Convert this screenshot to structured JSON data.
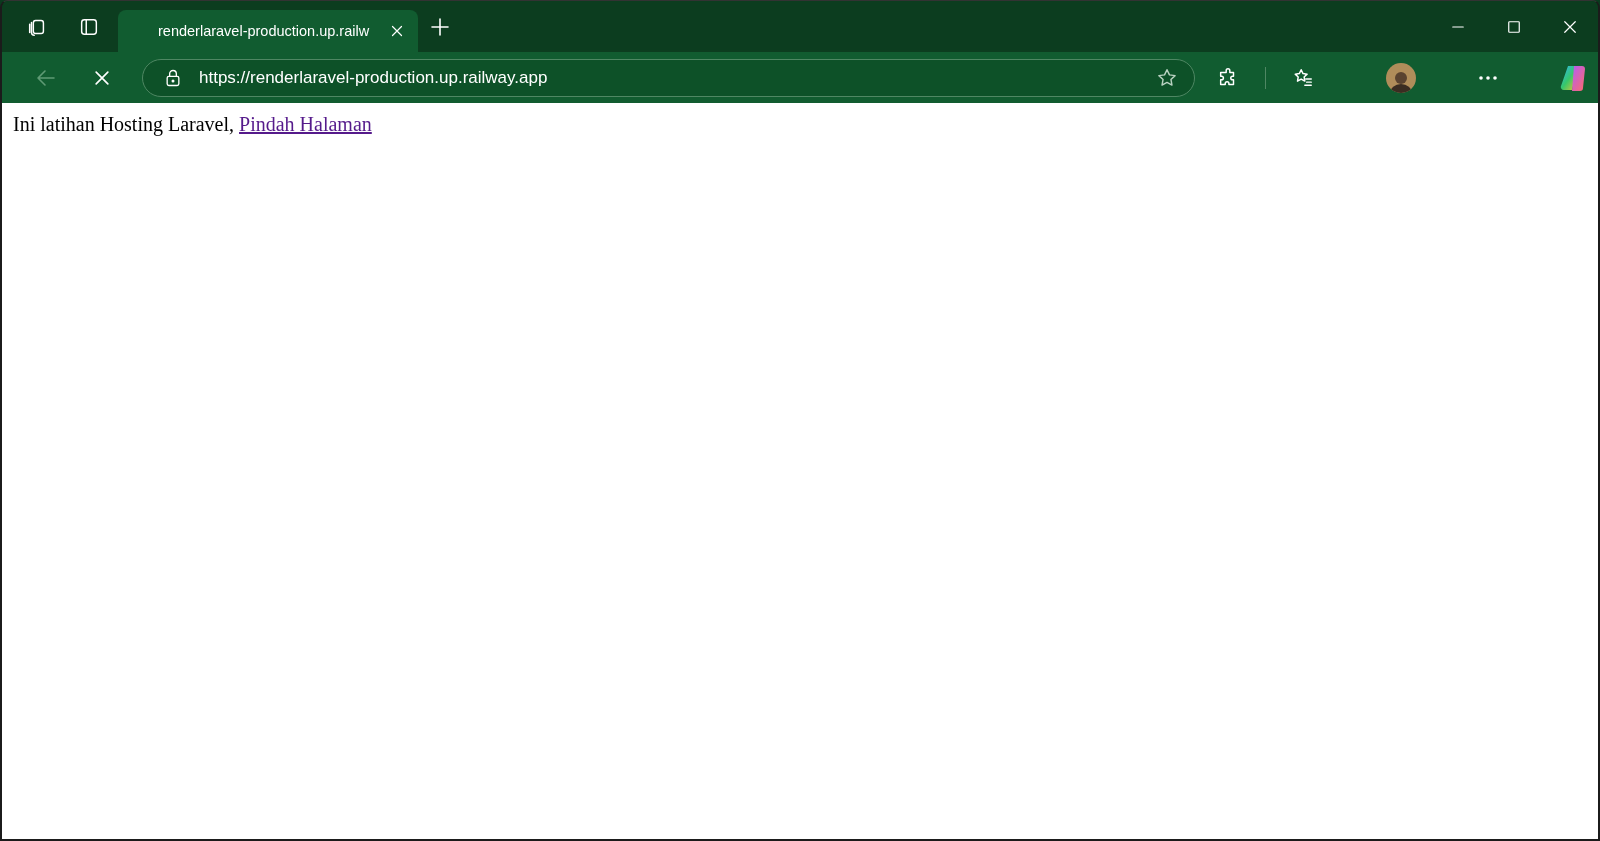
{
  "tabs": [
    {
      "title": "renderlaravel-production.up.railw",
      "selected": true
    }
  ],
  "toolbar": {
    "back_disabled": true,
    "url": "https://renderlaravel-production.up.railway.app"
  },
  "page": {
    "text": "Ini latihan Hosting Laravel,",
    "link": "Pindah Halaman"
  }
}
